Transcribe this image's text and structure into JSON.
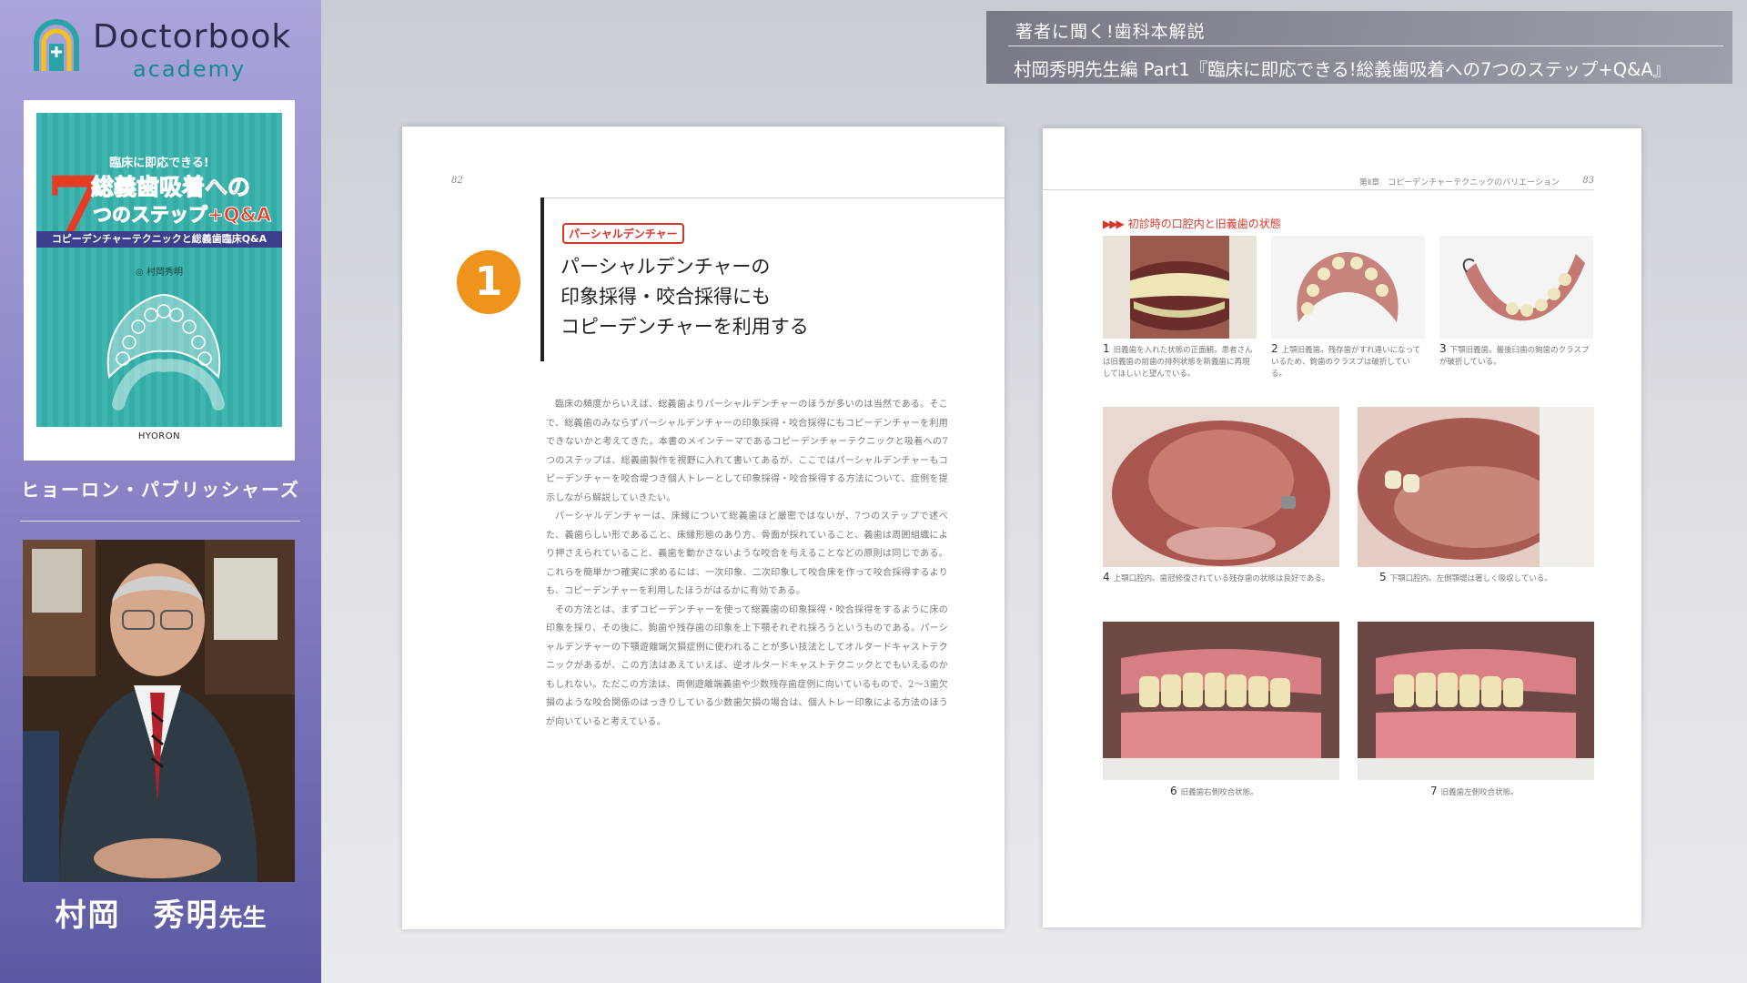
{
  "sidebar": {
    "logo_main": "Doctorbook",
    "logo_sub": "academy",
    "book_cover": {
      "top_line": "臨床に即応できる!",
      "big_number": "7",
      "title_line1": "総義歯吸着への",
      "title_line2": "つのステップ+Q&A",
      "band": "コピーデンチャーテクニックと総義歯臨床Q&A",
      "author": "◎ 村岡秀明",
      "publisher_mark": "HYORON"
    },
    "publisher": "ヒョーロン・パブリッシャーズ",
    "speaker_name": "村岡　秀明",
    "speaker_honorific": "先生"
  },
  "banner": {
    "category": "著者に聞く!歯科本解説",
    "title": "村岡秀明先生編 Part1『臨床に即応できる!総義歯吸着への7つのステップ+Q&A』"
  },
  "left_page": {
    "page_number": "82",
    "section_number": "1",
    "tag": "パーシャルデンチャー",
    "heading_lines": [
      "パーシャルデンチャーの",
      "印象採得・咬合採得にも",
      "コピーデンチャーを利用する"
    ],
    "paragraphs": [
      "臨床の頻度からいえば、総義歯よりパーシャルデンチャーのほうが多いのは当然である。そこで、総義歯のみならずパーシャルデンチャーの印象採得・咬合採得にもコピーデンチャーを利用できないかと考えてきた。本書のメインテーマであるコピーデンチャーテクニックと吸着への7つのステップは、総義歯製作を視野に入れて書いてあるが、ここではパーシャルデンチャーもコピーデンチャーを咬合堤つき個人トレーとして印象採得・咬合採得する方法について、症例を提示しながら解説していきたい。",
      "パーシャルデンチャーは、床縁について総義歯ほど厳密ではないが、7つのステップで述べた、義歯らしい形であること、床縁形態のあり方、骨面が採れていること、義歯は周囲組織により押さえられていること、義歯を動かさないような咬合を与えることなどの原則は同じである。これらを簡単かつ確実に求めるには、一次印象、二次印象して咬合床を作って咬合採得するよりも、コピーデンチャーを利用したほうがはるかに有効である。",
      "その方法とは、まずコピーデンチャーを使って総義歯の印象採得・咬合採得をするように床の印象を採り、その後に、鉤歯や残存歯の印象を上下顎それぞれ採ろうというものである。パーシャルデンチャーの下顎遊離端欠損症例に使われることが多い技法としてオルタードキャストテクニックがあるが、この方法はあえていえば、逆オルタードキャストテクニックとでもいえるのかもしれない。ただこの方法は、両側遊離端義歯や少数残存歯症例に向いているもので、2〜3歯欠損のような咬合関係のはっきりしている少数歯欠損の場合は、個人トレー印象による方法のほうが向いていると考えている。"
    ]
  },
  "right_page": {
    "running_head": "第Ⅱ章　コピーデンチャーテクニックのバリエーション",
    "page_number": "83",
    "section_label": "初診時の口腔内と旧義歯の状態",
    "figures": [
      {
        "num": "1",
        "caption": "旧義歯を入れた状態の正面観。患者さんは旧義歯の前歯の排列状態を新義歯に再現してほしいと望んでいる。"
      },
      {
        "num": "2",
        "caption": "上顎旧義歯。残存歯がすれ違いになっているため、鉤歯のクラスプは破折している。"
      },
      {
        "num": "3",
        "caption": "下顎旧義歯。最後臼歯の鉤歯のクラスプが破折している。"
      },
      {
        "num": "4",
        "caption": "上顎口腔内。歯冠修復されている残存歯の状態は良好である。"
      },
      {
        "num": "5",
        "caption": "下顎口腔内。左側顎堤は著しく吸収している。"
      },
      {
        "num": "6",
        "caption": "旧義歯右側咬合状態。"
      },
      {
        "num": "7",
        "caption": "旧義歯左側咬合状態。"
      }
    ]
  },
  "colors": {
    "sidebar_top": "#a9a4da",
    "sidebar_bottom": "#5c5aa4",
    "accent_orange": "#f0931c",
    "accent_red": "#d8352a",
    "cover_teal": "#3fb6b0"
  }
}
